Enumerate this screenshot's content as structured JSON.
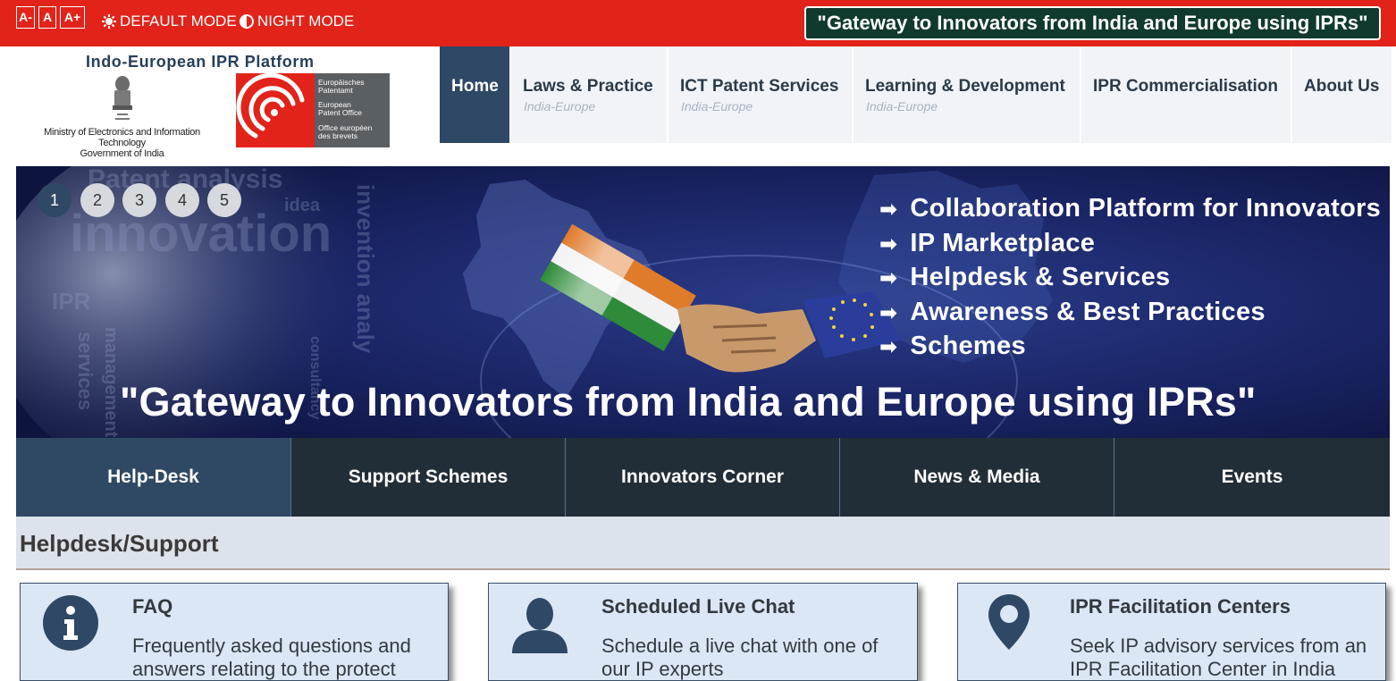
{
  "topbar": {
    "font_small": "A-",
    "font_normal": "A",
    "font_large": "A+",
    "default_mode": "DEFAULT MODE",
    "night_mode": "NIGHT MODE",
    "tagline": "\"Gateway to Innovators from India and Europe using IPRs\""
  },
  "logo": {
    "platform_title": "Indo-European IPR Platform",
    "ministry_line1": "Ministry of Electronics and Information Technology",
    "ministry_line2": "Government of India",
    "epo_de_1": "Europäisches",
    "epo_de_2": "Patentamt",
    "epo_en_1": "European",
    "epo_en_2": "Patent Office",
    "epo_fr_1": "Office européen",
    "epo_fr_2": "des brevets"
  },
  "nav": [
    {
      "label": "Home",
      "sub": ""
    },
    {
      "label": "Laws & Practice",
      "sub": "India-Europe"
    },
    {
      "label": "ICT Patent Services",
      "sub": "India-Europe"
    },
    {
      "label": "Learning & Development",
      "sub": "India-Europe"
    },
    {
      "label": "IPR Commercialisation",
      "sub": ""
    },
    {
      "label": "About Us",
      "sub": ""
    }
  ],
  "carousel": {
    "pages": [
      "1",
      "2",
      "3",
      "4",
      "5"
    ],
    "active_page": "1",
    "bullets": [
      "Collaboration Platform for Innovators",
      "IP Marketplace",
      "Helpdesk & Services",
      "Awareness & Best Practices",
      "Schemes"
    ],
    "tagline": "\"Gateway to Innovators from India and Europe using IPRs\"",
    "bg_words": [
      "Patent analysis",
      "innovation",
      "IPR",
      "idea",
      "invention analy",
      "services",
      "management",
      "consultancy"
    ]
  },
  "tabs": [
    {
      "label": "Help-Desk"
    },
    {
      "label": "Support Schemes"
    },
    {
      "label": "Innovators Corner"
    },
    {
      "label": "News & Media"
    },
    {
      "label": "Events"
    }
  ],
  "section": {
    "title": "Helpdesk/Support"
  },
  "cards": [
    {
      "title": "FAQ",
      "desc1": "Frequently asked questions and",
      "desc2": "answers relating to the protect",
      "icon": "info-icon"
    },
    {
      "title": "Scheduled Live Chat",
      "desc1": "Schedule a live chat with one of",
      "desc2": "our IP experts",
      "icon": "user-icon"
    },
    {
      "title": "IPR Facilitation Centers",
      "desc1": "Seek IP advisory services from an",
      "desc2": "IPR Facilitation Center in India",
      "icon": "map-pin-icon"
    }
  ],
  "colors": {
    "topbar": "#e2231a",
    "nav_active": "#2e4866",
    "tabbar": "#222e37",
    "tab_active": "#2f4965",
    "card_bg": "#dbe7f5"
  }
}
